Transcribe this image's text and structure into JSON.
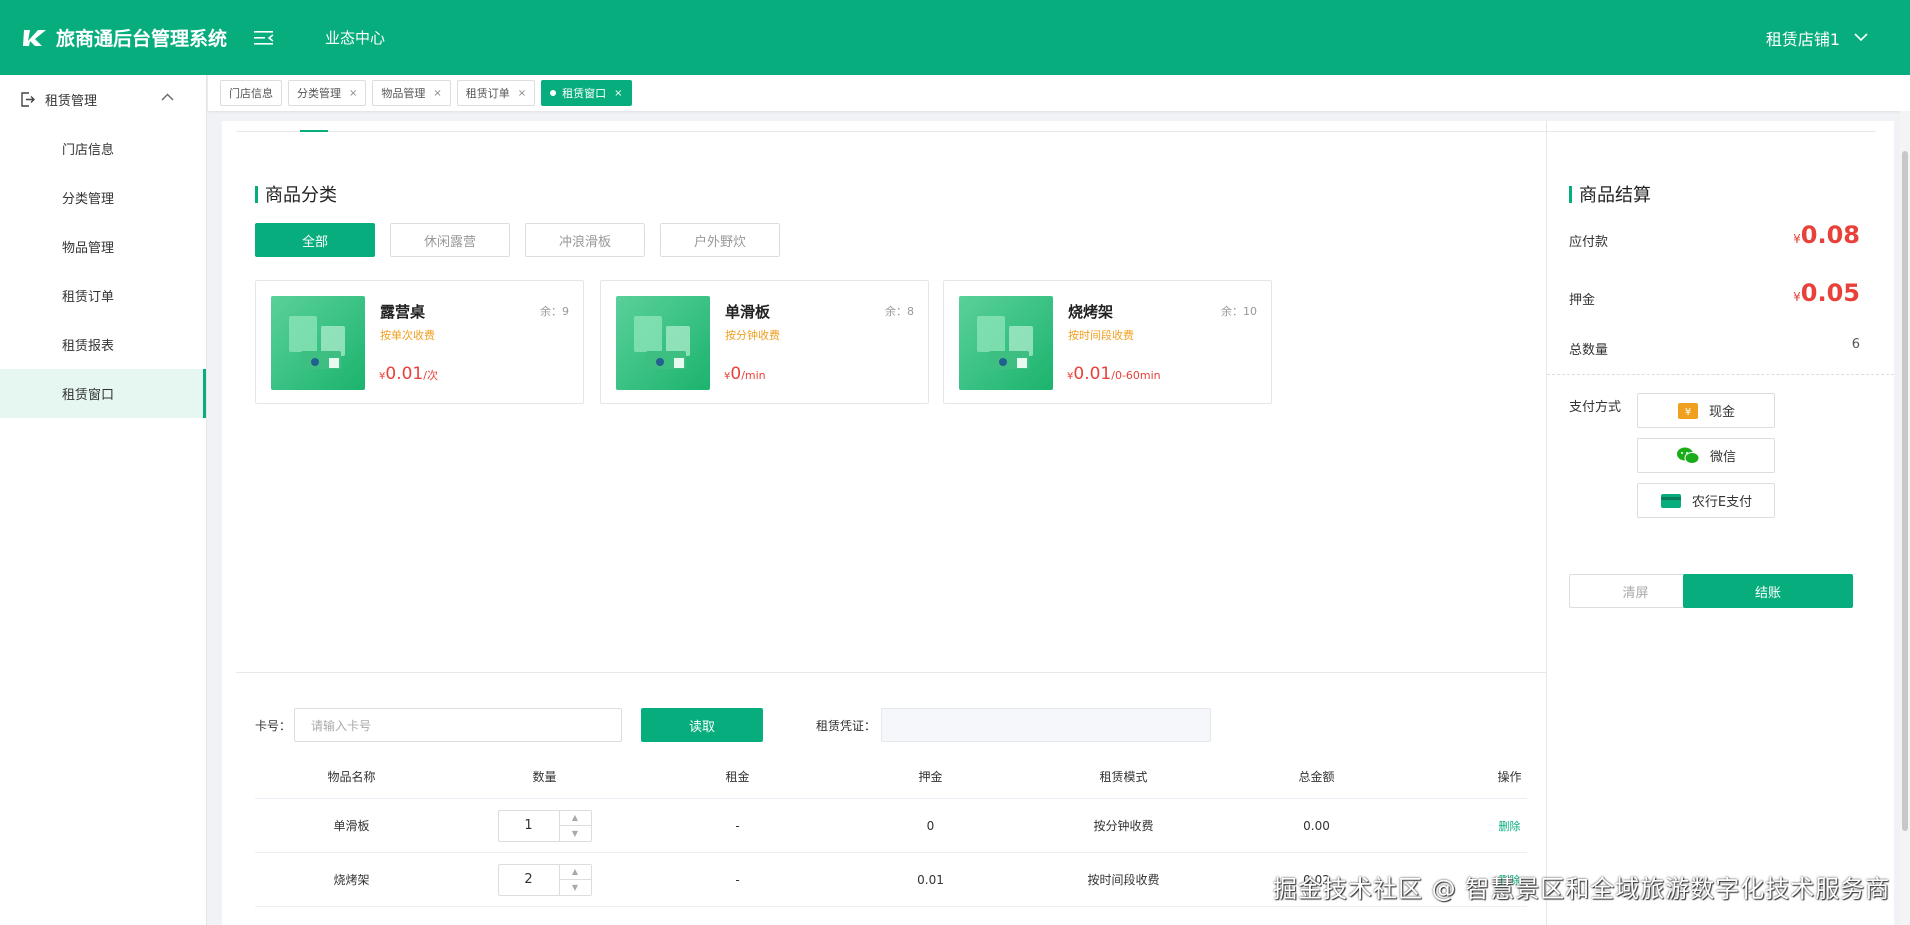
{
  "header": {
    "logo_mark": "K",
    "title": "旅商通后台管理系统",
    "nav": "业态中心",
    "user": "租赁店铺1"
  },
  "sidebar": {
    "group": "租赁管理",
    "items": [
      "门店信息",
      "分类管理",
      "物品管理",
      "租赁订单",
      "租赁报表",
      "租赁窗口"
    ],
    "active_index": 5
  },
  "tabs": [
    {
      "label": "门店信息",
      "closable": false
    },
    {
      "label": "分类管理",
      "closable": true
    },
    {
      "label": "物品管理",
      "closable": true
    },
    {
      "label": "租赁订单",
      "closable": true
    },
    {
      "label": "租赁窗口",
      "closable": true,
      "active": true
    }
  ],
  "tab_close": "×",
  "categories": {
    "title": "商品分类",
    "buttons": [
      "全部",
      "休闲露营",
      "冲浪滑板",
      "户外野炊"
    ]
  },
  "products": [
    {
      "name": "露营桌",
      "stock": "余：9",
      "mode": "按单次收费",
      "currency": "¥",
      "price": "0.01",
      "unit": "/次"
    },
    {
      "name": "单滑板",
      "stock": "余：8",
      "mode": "按分钟收费",
      "currency": "¥",
      "price": "0",
      "unit": "/min"
    },
    {
      "name": "烧烤架",
      "stock": "余：10",
      "mode": "按时间段收费",
      "currency": "¥",
      "price": "0.01",
      "unit": "/0-60min"
    }
  ],
  "card": {
    "label": "卡号：",
    "placeholder": "请输入卡号",
    "read_button": "读取",
    "voucher_label": "租赁凭证："
  },
  "table": {
    "headers": [
      "物品名称",
      "数量",
      "租金",
      "押金",
      "租赁模式",
      "总金额",
      "操作"
    ],
    "rows": [
      {
        "name": "单滑板",
        "qty": "1",
        "rent": "-",
        "deposit": "0",
        "mode": "按分钟收费",
        "total": "0.00",
        "action": "删除"
      },
      {
        "name": "烧烤架",
        "qty": "2",
        "rent": "-",
        "deposit": "0.01",
        "mode": "按时间段收费",
        "total": "0.02",
        "action": "删除"
      }
    ]
  },
  "settlement": {
    "title": "商品结算",
    "payable_label": "应付款",
    "payable_currency": "¥",
    "payable_value": "0.08",
    "deposit_label": "押金",
    "deposit_currency": "¥",
    "deposit_value": "0.05",
    "count_label": "总数量",
    "count_value": "6",
    "pay_label": "支付方式",
    "pay_methods": [
      "现金",
      "微信",
      "农行E支付"
    ],
    "cash_glyph": "¥",
    "clear_button": "清屏",
    "settle_button": "结账"
  },
  "watermark": "掘金技术社区 @ 智慧景区和全域旅游数字化技术服务商",
  "colors": {
    "primary": "#08ad7e",
    "price": "#e8413a",
    "mode": "#f0a020"
  }
}
